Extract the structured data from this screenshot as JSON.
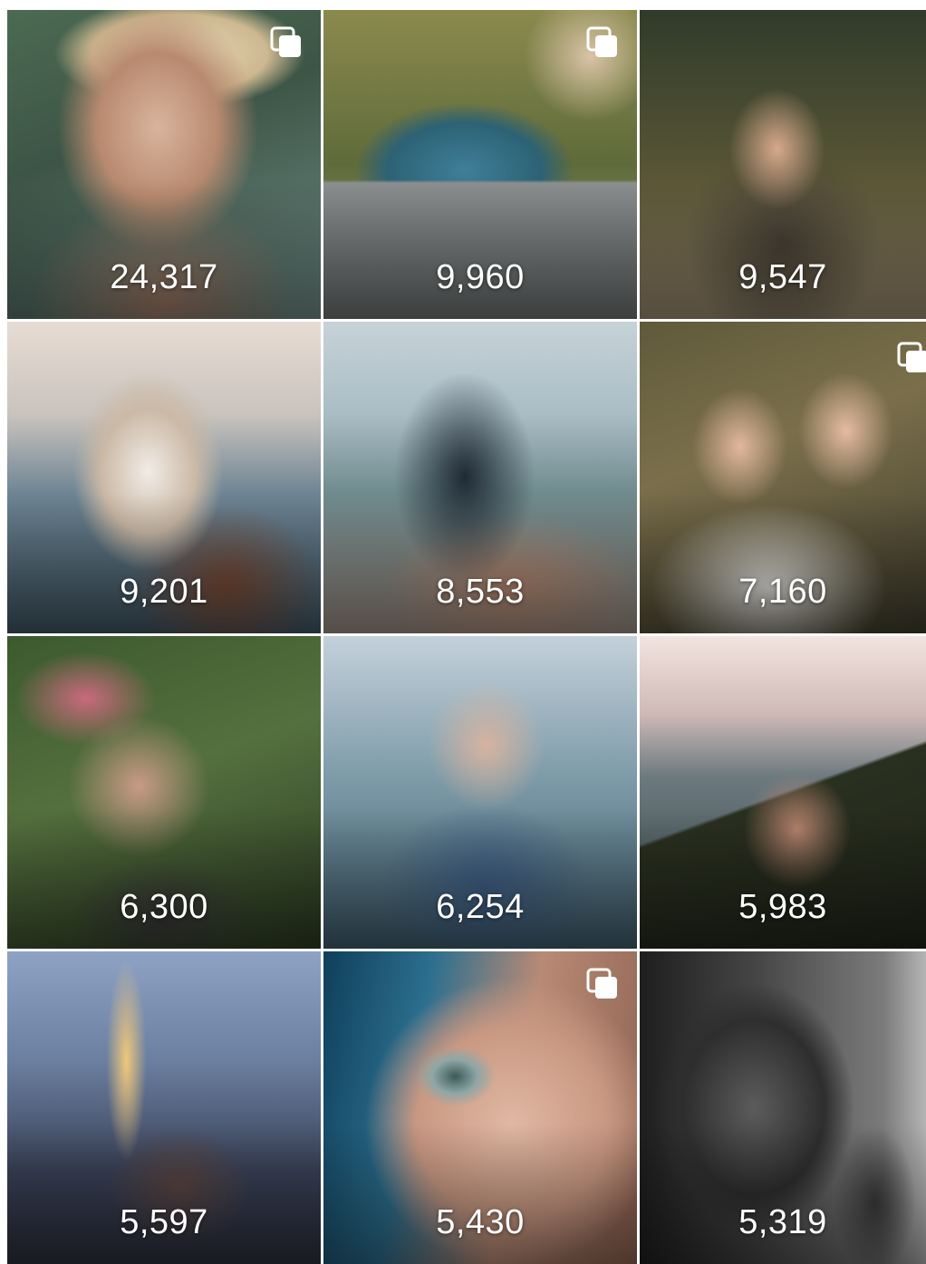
{
  "grid": {
    "tiles": [
      {
        "count": "24,317",
        "multi": true
      },
      {
        "count": "9,960",
        "multi": true
      },
      {
        "count": "9,547",
        "multi": false
      },
      {
        "count": "9,201",
        "multi": false
      },
      {
        "count": "8,553",
        "multi": false
      },
      {
        "count": "7,160",
        "multi": true
      },
      {
        "count": "6,300",
        "multi": false
      },
      {
        "count": "6,254",
        "multi": false
      },
      {
        "count": "5,983",
        "multi": false
      },
      {
        "count": "5,597",
        "multi": false
      },
      {
        "count": "5,430",
        "multi": true
      },
      {
        "count": "5,319",
        "multi": false
      }
    ]
  },
  "icons": {
    "multi_post": "carousel-icon"
  },
  "colors": {
    "count_text": "#ffffff",
    "background": "#ffffff"
  }
}
